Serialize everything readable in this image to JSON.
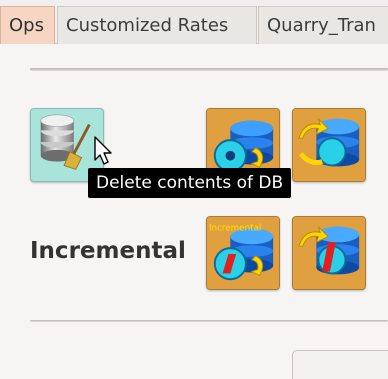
{
  "tabs": [
    {
      "label": "Ops",
      "active": true
    },
    {
      "label": "Customized Rates",
      "active": false
    },
    {
      "label": "Quarry_Tran",
      "active": false
    }
  ],
  "section": {
    "incremental_label": "Incremental"
  },
  "buttons": {
    "delete": {
      "icon": "database-delete-icon"
    },
    "full_import": {
      "icon": "database-sync-icon"
    },
    "full_export": {
      "icon": "database-export-icon"
    },
    "incremental_import": {
      "icon": "database-sync-icon",
      "overlay_text": "Incremental"
    },
    "incremental_export": {
      "icon": "database-export-icon"
    }
  },
  "tooltip": {
    "text": "Delete contents of DB"
  },
  "colors": {
    "active_tab": "#f6d6c2",
    "delete_button_bg": "#a9e4da",
    "action_button_bg": "#e0a040",
    "tooltip_bg": "#000000"
  }
}
